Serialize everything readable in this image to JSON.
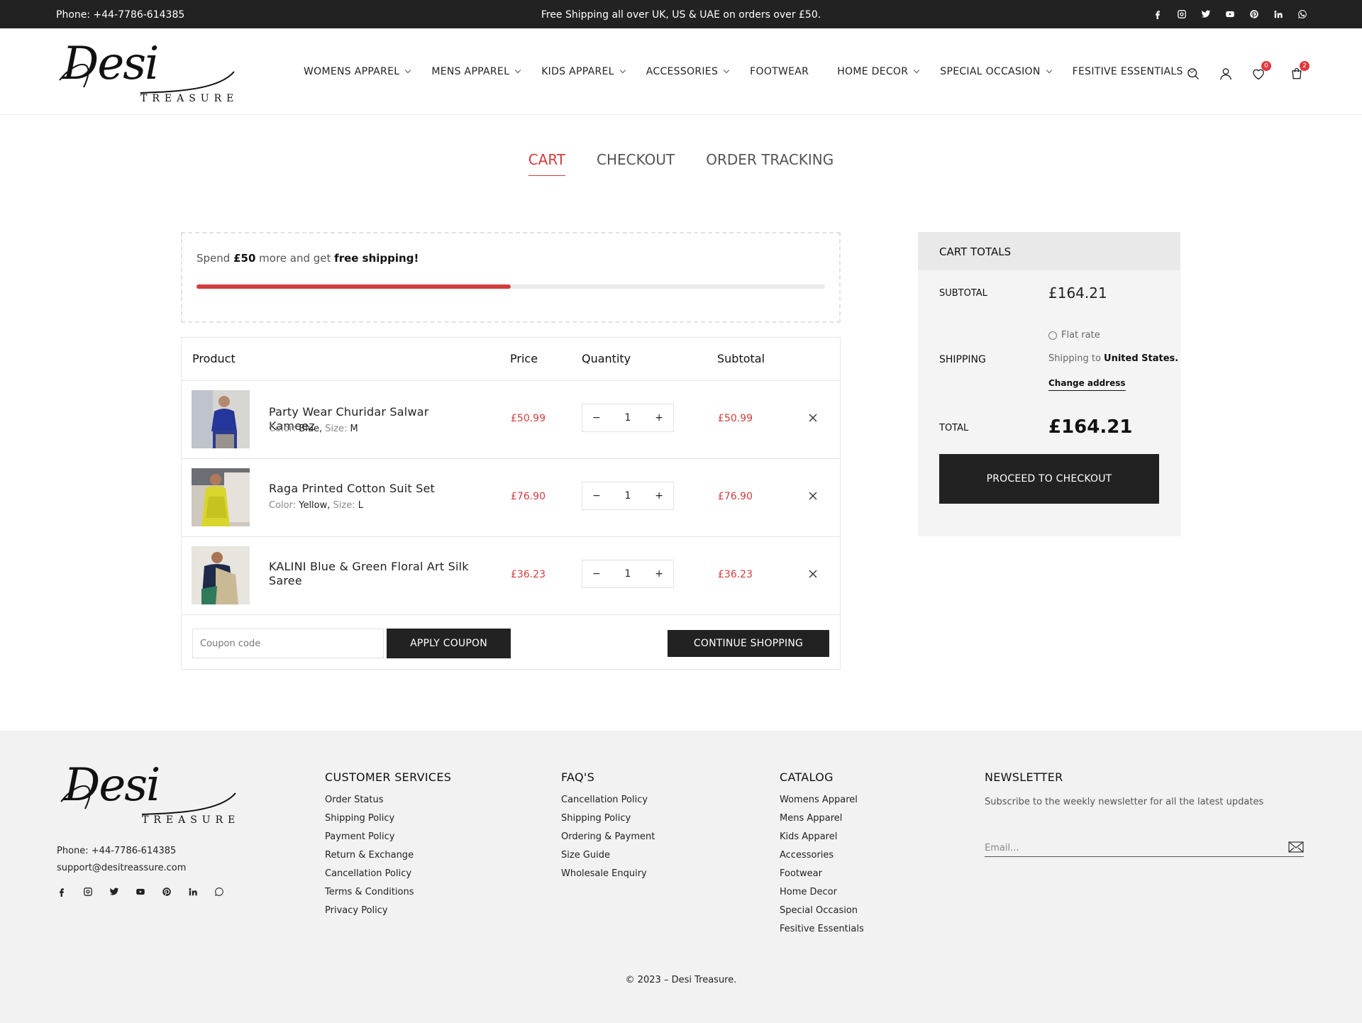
{
  "topbar": {
    "phone": "Phone: +44-7786-614385",
    "promo": "Free Shipping all over UK, US & UAE on orders over £50.",
    "socials": [
      "facebook-icon",
      "instagram-icon",
      "twitter-icon",
      "youtube-icon",
      "pinterest-icon",
      "linkedin-icon",
      "whatsapp-icon"
    ]
  },
  "brand": {
    "script": "Desi",
    "word": "TREASURE"
  },
  "nav": [
    {
      "label": "WOMENS APPAREL"
    },
    {
      "label": "MENS APPAREL"
    },
    {
      "label": "KIDS APPAREL"
    },
    {
      "label": "ACCESSORIES"
    },
    {
      "label": "FOOTWEAR"
    },
    {
      "label": "HOME DECOR"
    },
    {
      "label": "SPECIAL OCCASION"
    },
    {
      "label": "FESITIVE ESSENTIALS"
    }
  ],
  "header_icons": {
    "wishlist_count": "0",
    "cart_count": "2"
  },
  "steps": {
    "cart": "CART",
    "checkout": "CHECKOUT",
    "tracking": "ORDER TRACKING"
  },
  "freeship": {
    "pre": "Spend ",
    "amount": "£50",
    "mid": " more and get ",
    "strong": "free shipping!",
    "progress": 0.5
  },
  "cart": {
    "headers": {
      "product": "Product",
      "price": "Price",
      "quantity": "Quantity",
      "subtotal": "Subtotal"
    },
    "items": [
      {
        "name": "Party Wear Churidar Salwar Kameez",
        "color_label": "Color:",
        "color": "Blue,",
        "size_label": "Size:",
        "size": "M",
        "price": "£50.99",
        "qty": "1",
        "subtotal": "£50.99"
      },
      {
        "name": "Raga Printed Cotton Suit Set",
        "color_label": "Color:",
        "color": "Yellow,",
        "size_label": "Size:",
        "size": "L",
        "price": "£76.90",
        "qty": "1",
        "subtotal": "£76.90"
      },
      {
        "name": "KALINI Blue & Green Floral Art Silk Saree",
        "price": "£36.23",
        "qty": "1",
        "subtotal": "£36.23"
      }
    ],
    "qty_minus": "−",
    "qty_plus": "+",
    "coupon_placeholder": "Coupon code",
    "apply_coupon": "APPLY COUPON",
    "continue_shopping": "CONTINUE SHOPPING"
  },
  "totals": {
    "title": "CART TOTALS",
    "subtotal_label": "SUBTOTAL",
    "subtotal": "£164.21",
    "shipping_label": "SHIPPING",
    "flat_rate": "Flat rate",
    "shipping_to": "Shipping to ",
    "shipping_country": "United States.",
    "change_address": "Change address",
    "total_label": "TOTAL",
    "total": "£164.21",
    "checkout_button": "PROCEED TO CHECKOUT"
  },
  "footer": {
    "phone": "Phone: +44-7786-614385",
    "email": "support@desitreassure.com",
    "customer_services": {
      "title": "CUSTOMER SERVICES",
      "links": [
        "Order Status",
        "Shipping Policy",
        "Payment Policy",
        "Return & Exchange",
        "Cancellation Policy",
        "Terms & Conditions",
        "Privacy Policy"
      ]
    },
    "faqs": {
      "title": "FAQ'S",
      "links": [
        "Cancellation Policy",
        "Shipping Policy",
        "Ordering & Payment",
        "Size Guide",
        "Wholesale Enquiry"
      ]
    },
    "catalog": {
      "title": "CATALOG",
      "links": [
        "Womens Apparel",
        "Mens Apparel",
        "Kids Apparel",
        "Accessories",
        "Footwear",
        "Home Decor",
        "Special Occasion",
        "Fesitive Essentials"
      ]
    },
    "newsletter": {
      "title": "NEWSLETTER",
      "text": "Subscribe to the weekly newsletter for all the latest updates",
      "placeholder": "Email..."
    },
    "copyright": "© 2023 – Desi Treasure."
  },
  "colors": {
    "accent": "#d23c3c",
    "dark": "#222222",
    "footer_bg": "#f2f2f2"
  }
}
